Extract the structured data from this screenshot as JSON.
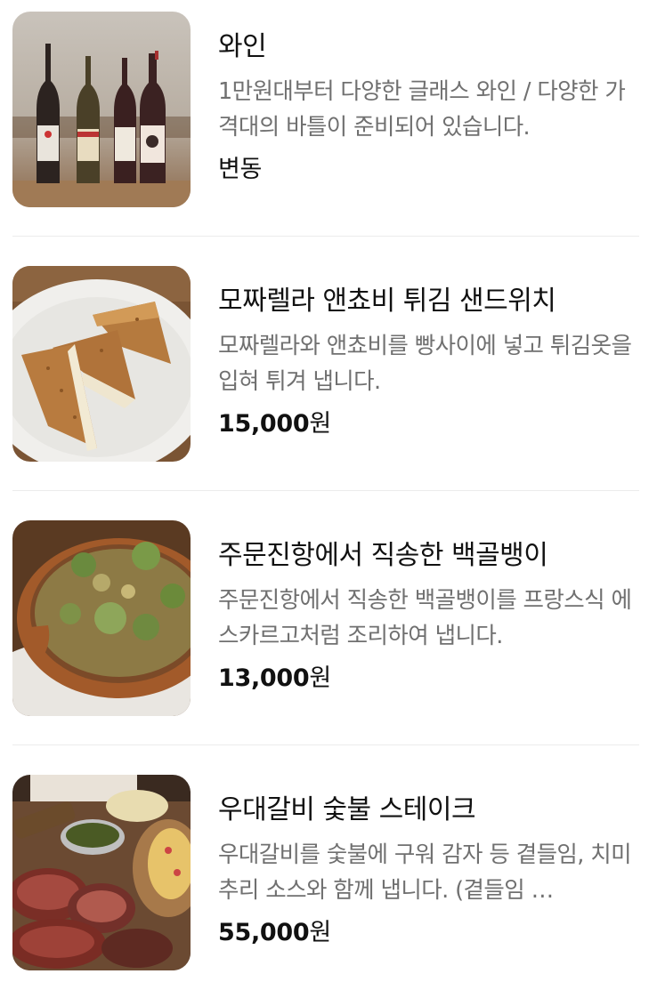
{
  "menu": {
    "items": [
      {
        "name": "와인",
        "description": "1만원대부터 다양한 글래스 와인 / 다양한 가격대의 바틀이 준비되어 있습니다.",
        "price": "변동",
        "currency": "",
        "image": "wine-bottles-photo"
      },
      {
        "name": "모짜렐라 앤쵸비 튀김 샌드위치",
        "description": "모짜렐라와 앤쵸비를 빵사이에 넣고 튀김옷을 입혀 튀겨 냅니다.",
        "price": "15,000",
        "currency": "원",
        "image": "fried-sandwich-photo"
      },
      {
        "name": "주문진항에서 직송한 백골뱅이",
        "description": "주문진항에서 직송한 백골뱅이를 프랑스식 에스카르고처럼 조리하여 냅니다.",
        "price": "13,000",
        "currency": "원",
        "image": "whelk-escargot-photo"
      },
      {
        "name": "우대갈비 숯불 스테이크",
        "description": "우대갈비를 숯불에 구워 감자 등 곁들임, 치미추리 소스와 함께 냅니다. (곁들임 …",
        "price": "55,000",
        "currency": "원",
        "image": "beef-rib-steak-photo"
      }
    ]
  }
}
